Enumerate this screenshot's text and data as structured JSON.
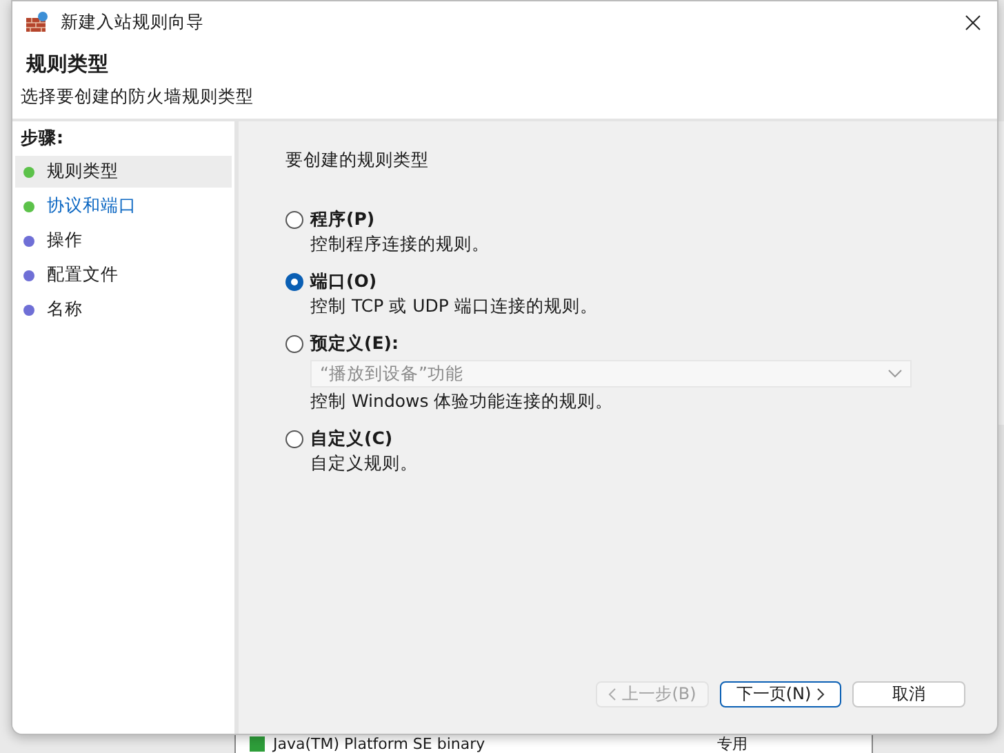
{
  "window": {
    "title": "新建入站规则向导"
  },
  "header": {
    "title": "规则类型",
    "subtitle": "选择要创建的防火墙规则类型"
  },
  "steps": {
    "heading": "步骤:",
    "items": [
      {
        "label": "规则类型",
        "selected": true,
        "link": false,
        "color": "#5cc24a"
      },
      {
        "label": "协议和端口",
        "selected": false,
        "link": true,
        "color": "#5cc24a"
      },
      {
        "label": "操作",
        "selected": false,
        "link": false,
        "color": "#6f6fd6"
      },
      {
        "label": "配置文件",
        "selected": false,
        "link": false,
        "color": "#6f6fd6"
      },
      {
        "label": "名称",
        "selected": false,
        "link": false,
        "color": "#6f6fd6"
      }
    ]
  },
  "content": {
    "prompt": "要创建的规则类型",
    "options": [
      {
        "label": "程序(P)",
        "description": "控制程序连接的规则。",
        "selected": false
      },
      {
        "label": "端口(O)",
        "description": "控制 TCP 或 UDP 端口连接的规则。",
        "selected": true
      },
      {
        "label": "预定义(E):",
        "description": "控制 Windows 体验功能连接的规则。",
        "selected": false,
        "dropdown": {
          "value": "“播放到设备”功能",
          "disabled": true
        }
      },
      {
        "label": "自定义(C)",
        "description": "自定义规则。",
        "selected": false
      }
    ]
  },
  "buttons": [
    {
      "label": "上一步(B)",
      "kind": "back",
      "disabled": true
    },
    {
      "label": "下一页(N)",
      "kind": "next",
      "disabled": false
    },
    {
      "label": "取消",
      "kind": "plain",
      "disabled": false
    }
  ],
  "background": {
    "row_name": "Java(TM) Platform SE binary",
    "row_profile": "专用"
  }
}
